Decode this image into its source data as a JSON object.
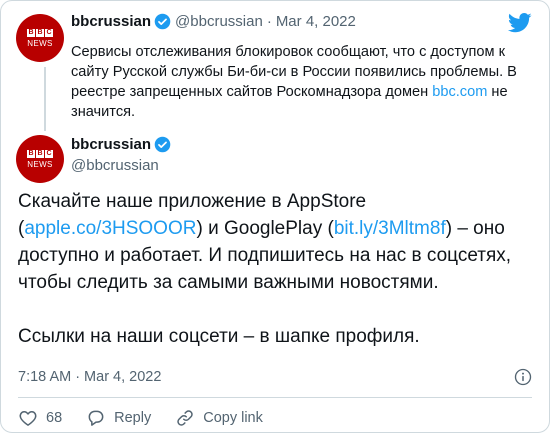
{
  "quoted": {
    "name": "bbcrussian",
    "handle": "@bbcrussian",
    "date": "Mar 4, 2022",
    "text_part1": "Сервисы отслеживания блокировок сообщают, что с доступом к сайту Русской службы Би-би-си в России появились проблемы. В реестре запрещенных сайтов Роскомнадзора домен ",
    "text_link": "bbc.com",
    "text_part2": " не значится."
  },
  "main": {
    "name": "bbcrussian",
    "handle": "@bbcrussian",
    "body_1": "Скачайте наше приложение в AppStore (",
    "link_1": "apple.co/3HSOOOR",
    "body_2": ") и GooglePlay (",
    "link_2": "bit.ly/3Mltm8f",
    "body_3": ") – оно доступно и работает. И подпишитесь на нас в соцсетях, чтобы следить за самыми важными новостями.",
    "body_4": "Ссылки на наши соцсети – в шапке профиля.",
    "time": "7:18 AM",
    "date": "Mar 4, 2022"
  },
  "actions": {
    "likes": "68",
    "reply": "Reply",
    "copy_link": "Copy link"
  },
  "logo": {
    "blocks": [
      "B",
      "B",
      "C"
    ],
    "news": "NEWS"
  },
  "colors": {
    "brand": "#b80000",
    "link": "#1d9bf0",
    "verified": "#1d9bf0",
    "muted": "#536471"
  },
  "icons": [
    "twitter-bird-icon",
    "verified-badge-icon",
    "info-icon",
    "heart-icon",
    "reply-icon",
    "link-icon"
  ]
}
